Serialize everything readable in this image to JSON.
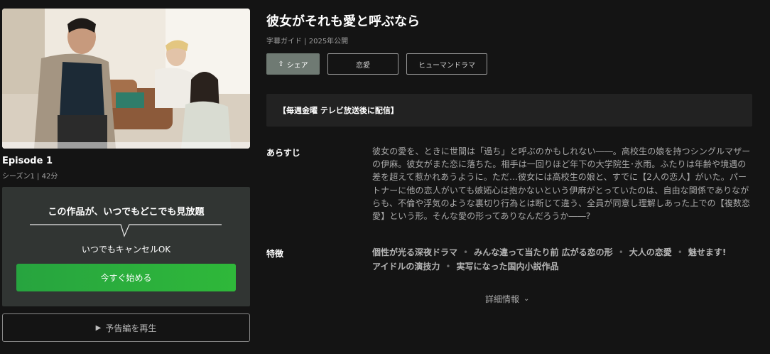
{
  "episode": {
    "title": "Episode 1",
    "meta": "シーズン1 | 42分"
  },
  "promo": {
    "heading": "この作品が、いつでもどこでも見放題",
    "sub": "いつでもキャンセルOK",
    "start_label": "今すぐ始める"
  },
  "trailer": {
    "label": "予告編を再生",
    "icon": "play-icon"
  },
  "show": {
    "title": "彼女がそれも愛と呼ぶなら",
    "subinfo": "字幕ガイド | 2025年公開"
  },
  "chips": {
    "share_label": "シェア",
    "genre1": "恋愛",
    "genre2": "ヒューマンドラマ"
  },
  "notice": "【毎週金曜 テレビ放送後に配信】",
  "synopsis": {
    "label": "あらすじ",
    "text": "彼女の愛を、ときに世間は「過ち」と呼ぶのかもしれない――。高校生の娘を持つシングルマザーの伊麻。彼女がまた恋に落ちた。相手は一回りほど年下の大学院生･氷雨。ふたりは年齢や境遇の差を超えて惹かれあうように。ただ…彼女には高校生の娘と、すでに【2人の恋人】がいた。パートナーに他の恋人がいても嫉妬心は抱かないという伊麻がとっていたのは、自由な関係でありながらも、不倫や浮気のような裏切り行為とは断じて違う、全員が同意し理解しあった上での【複数恋愛】という形。そんな愛の形ってありなんだろうか――?"
  },
  "features": {
    "label": "特徴",
    "items": [
      "個性が光る深夜ドラマ",
      "みんな違って当たり前 広がる恋の形",
      "大人の恋愛",
      "魅せます!",
      "アイドルの演技力",
      "実写になった国内小説作品"
    ]
  },
  "detail_label": "詳細情報",
  "colors": {
    "background": "#141414",
    "accent_green": "#2fb83a",
    "promo_panel": "#313533",
    "share_chip": "#6f7a73"
  }
}
